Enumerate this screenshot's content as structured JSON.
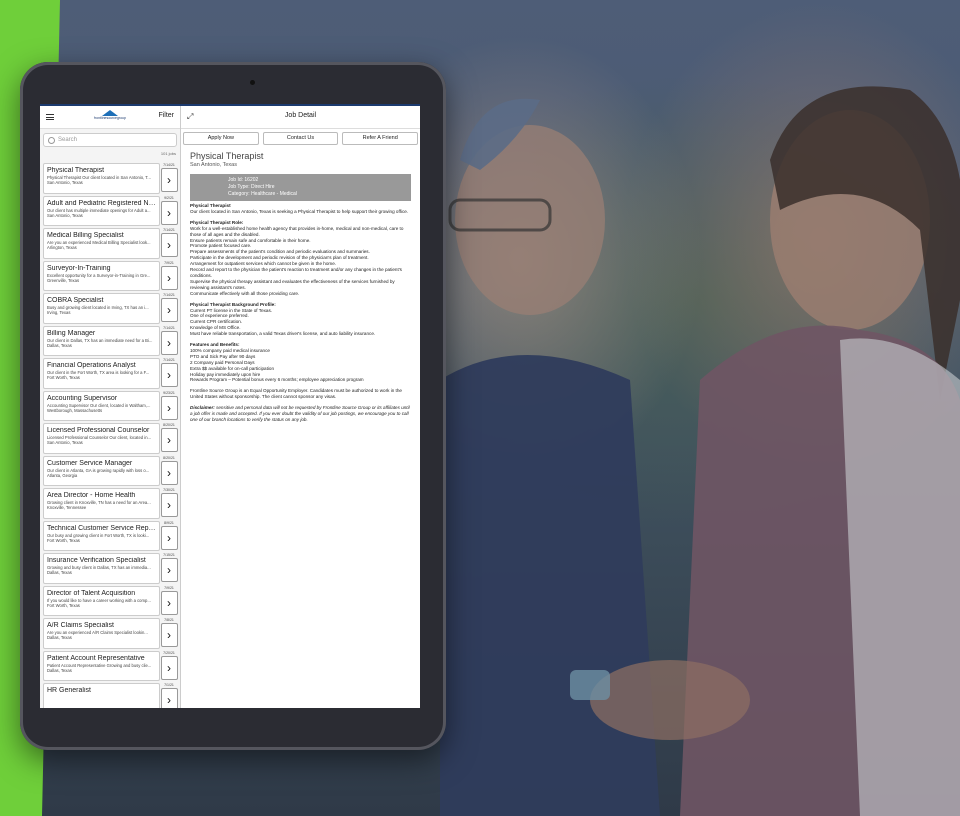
{
  "sidebar": {
    "filter_label": "Filter",
    "search_placeholder": "Search",
    "count": "101 jobs",
    "logo_text": "frontlinesourcegroup",
    "items": [
      {
        "title": "Physical Therapist",
        "desc": "Physical Therapist Our client located in San Antonio, T...",
        "loc": "San Antonio, Texas",
        "date": "7/14/21"
      },
      {
        "title": "Adult and Pediatric Registered Nurse",
        "desc": "Our client has multiple immediate openings for Adult a...",
        "loc": "San Antonio, Texas",
        "date": "9/2/21"
      },
      {
        "title": "Medical Billing Specialist",
        "desc": "Are you an experienced Medical Billing Specialist look...",
        "loc": "Arlington, Texas",
        "date": "7/14/21"
      },
      {
        "title": "Surveyor-In-Training",
        "desc": "Excellent opportunity for a Surveyor-in-Training in Gre...",
        "loc": "Greenville, Texas",
        "date": "7/9/21"
      },
      {
        "title": "COBRA Specialist",
        "desc": "Busy and growing client located in Irving, TX has an i...",
        "loc": "Irving, Texas",
        "date": "7/14/21"
      },
      {
        "title": "Billing Manager",
        "desc": "Our client in Dallas, TX has an immediate need for a Bi...",
        "loc": "Dallas, Texas",
        "date": "7/14/21"
      },
      {
        "title": "Financial Operations Analyst",
        "desc": "Our client in the Fort Worth, TX area is looking for a F...",
        "loc": "Fort Worth, Texas",
        "date": "7/14/21"
      },
      {
        "title": "Accounting Supervisor",
        "desc": "Accounting Supervisor Our client, located in Waltham,...",
        "loc": "Westborough, Massachusetts",
        "date": "9/23/21"
      },
      {
        "title": "Licensed Professional Counselor",
        "desc": "Licensed Professional Counselor Our client, located in...",
        "loc": "San Antonio, Texas",
        "date": "8/20/21"
      },
      {
        "title": "Customer Service Manager",
        "desc": "Our client in Atlanta, GA is growing rapidly with loss o...",
        "loc": "Atlanta, Georgia",
        "date": "8/20/21"
      },
      {
        "title": "Area Director - Home Health",
        "desc": "Growing client in Knoxville, TN has a need for an Area...",
        "loc": "Knoxville, Tennessee",
        "date": "7/30/21"
      },
      {
        "title": "Technical Customer Service Represe...",
        "desc": "Our busy and growing client in Fort Worth, TX is looki...",
        "loc": "Fort Worth, Texas",
        "date": "8/9/21"
      },
      {
        "title": "Insurance Verification Specialist",
        "desc": "Growing and busy client in Dallas, TX has an immedia...",
        "loc": "Dallas, Texas",
        "date": "7/15/21"
      },
      {
        "title": "Director of Talent Acquisition",
        "desc": "If you would like to have a career working with a comp...",
        "loc": "Fort Worth, Texas",
        "date": "7/9/21"
      },
      {
        "title": "A/R Claims Specialist",
        "desc": "Are you an experienced A/R Claims Specialist lookin...",
        "loc": "Dallas, Texas",
        "date": "7/8/21"
      },
      {
        "title": "Patient Account Representative",
        "desc": "Patient Account Representative Growing and busy clie...",
        "loc": "Dallas, Texas",
        "date": "7/20/21"
      },
      {
        "title": "HR Generalist",
        "desc": "",
        "loc": "",
        "date": "7/1/21"
      }
    ]
  },
  "detail": {
    "header_title": "Job Detail",
    "buttons": [
      "Apply Now",
      "Contact Us",
      "Refer A Friend"
    ],
    "job_title": "Physical Therapist",
    "location": "San Antonio, Texas",
    "job_id": "Job Id: 16202",
    "job_type": "Job Type: Direct Hire",
    "category": "Category: Healthcare - Medical",
    "heading1": "Physical Therapist",
    "intro": "Our client located in San Antonio, Texas is seeking a Physical Therapist to help support their growing office.",
    "role_heading": "Physical Therapist Role:",
    "role_lines": [
      "Work for a well-established home health agency that provides in-home, medical and non-medical, care to those of all ages and the disabled.",
      "Ensure patients remain safe and comfortable in their home.",
      "Promote patient focused care.",
      "Prepare assessments of the patient's condition and periodic evaluations and summaries.",
      "Participate in the development and periodic revision of the physician's plan of treatment.",
      "Arrangement for outpatient services which cannot be given in the home.",
      "Record and report to the physician the patient's reaction to treatment and/or any changes in the patient's conditions.",
      "Supervise the physical therapy assistant and evaluates the effectiveness of the services furnished by reviewing assistant's notes.",
      "Communicate effectively with all those providing care."
    ],
    "profile_heading": "Physical Therapist Background Profile:",
    "profile_lines": [
      "Current PT license in the State of Texas.",
      "One of experience preferred.",
      "Current CPR certification.",
      "Knowledge of MS Office.",
      "Must have reliable transportation, a valid Texas driver's license, and auto liability insurance."
    ],
    "features_heading": "Features and Benefits:",
    "features_lines": [
      "100% company paid medical insurance",
      "PTO and Sick Pay after 90 days",
      "2 Company paid Personal Days",
      "Extra $$ available for on-call participation",
      "Holiday pay immediately upon hire",
      "Rewards Program – Potential bonus every 6 months; employee appreciation program"
    ],
    "eeo": "Frontline Source Group is an Equal Opportunity Employer. Candidates must be authorized to work in the United States without sponsorship. The client cannot sponsor any visas.",
    "disclaimer_label": "Disclaimer:",
    "disclaimer": "sensitive and personal data will not be requested by Frontline Source Group or its affiliates until a job offer is made and accepted. If you ever doubt the validity of our job postings, we encourage you to call one of our branch locations to verify the status on any job."
  },
  "colors": {
    "accent_green": "#6fcf3a",
    "nav_blue": "#1c3a6e"
  }
}
